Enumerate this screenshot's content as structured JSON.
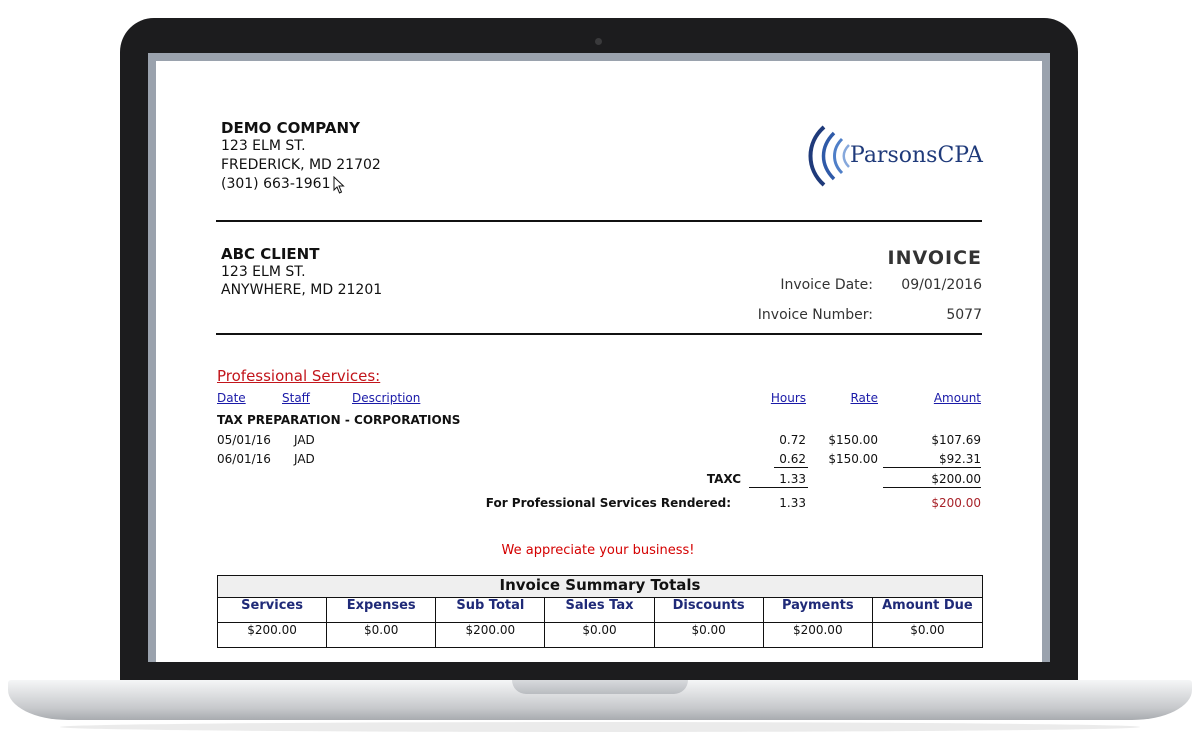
{
  "company": {
    "name": "DEMO COMPANY",
    "address1": "123 ELM ST.",
    "address2": "FREDERICK, MD  21702",
    "phone": "(301) 663-1961"
  },
  "logo": {
    "text": "ParsonsCPA",
    "icon": "waves-logo-icon"
  },
  "client": {
    "name": "ABC CLIENT",
    "address1": "123 ELM ST.",
    "address2": "ANYWHERE, MD  21201"
  },
  "invoice": {
    "title": "INVOICE",
    "date_label": "Invoice Date:",
    "date": "09/01/2016",
    "number_label": "Invoice Number:",
    "number": "5077"
  },
  "services": {
    "heading": "Professional Services:",
    "columns": {
      "date": "Date",
      "staff": "Staff",
      "description": "Description",
      "hours": "Hours",
      "rate": "Rate",
      "amount": "Amount"
    },
    "category": "TAX PREPARATION - CORPORATIONS",
    "rows": [
      {
        "date": "05/01/16",
        "staff": "JAD",
        "hours": "0.72",
        "rate": "$150.00",
        "amount": "$107.69"
      },
      {
        "date": "06/01/16",
        "staff": "JAD",
        "hours": "0.62",
        "rate": "$150.00",
        "amount": "$92.31"
      }
    ],
    "subtotal": {
      "label": "TAXC",
      "hours": "1.33",
      "amount": "$200.00"
    },
    "total": {
      "label": "For Professional Services Rendered:",
      "hours": "1.33",
      "amount": "$200.00"
    }
  },
  "thanks": "We appreciate your business!",
  "summary": {
    "title": "Invoice Summary Totals",
    "headers": [
      "Services",
      "Expenses",
      "Sub Total",
      "Sales Tax",
      "Discounts",
      "Payments",
      "Amount Due"
    ],
    "values": [
      "$200.00",
      "$0.00",
      "$200.00",
      "$0.00",
      "$0.00",
      "$200.00",
      "$0.00"
    ]
  },
  "colors": {
    "accent_red": "#c2151b",
    "link_blue": "#1a1aa8",
    "header_navy": "#1f2a78",
    "logo_blue": "#1f3a7a"
  }
}
